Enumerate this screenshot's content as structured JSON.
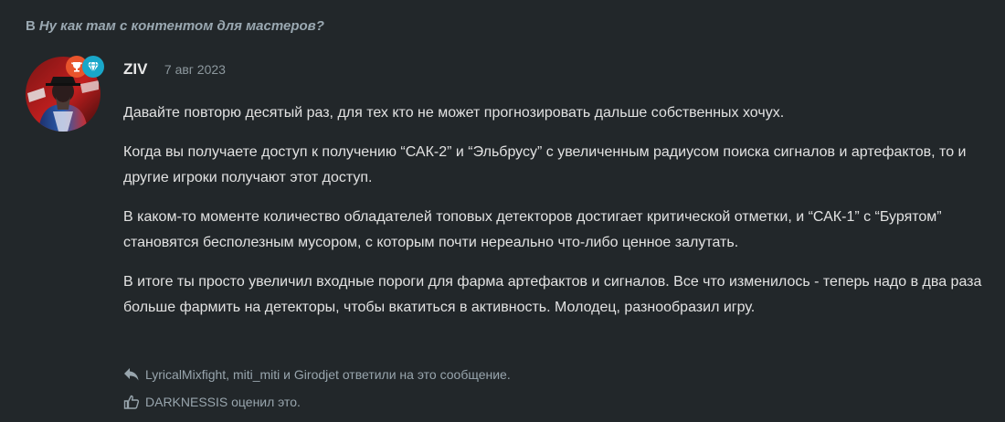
{
  "thread": {
    "prefix": "В",
    "title": "Ну как там с контентом для мастеров?"
  },
  "post": {
    "username": "ZIV",
    "date": "7 авг 2023",
    "paragraphs": [
      "Давайте повторю десятый раз, для тех кто не может прогнозировать дальше собственных хочух.",
      "Когда вы получаете доступ к получению “САК-2” и “Эльбрусу” с увеличенным радиусом поиска сигналов и артефактов, то и другие игроки получают этот доступ.",
      "В каком-то моменте количество обладателей топовых детекторов достигает критической отметки, и “САК-1” с “Бурятом” становятся бесполезным мусором, с которым почти нереально что-либо ценное залутать.",
      "В итоге ты просто увеличил входные пороги для фарма артефактов и сигналов. Все что изменилось - теперь надо в два раза больше фармить на детекторы, чтобы вкатиться в активность. Молодец, разнообразил игру."
    ],
    "replies": {
      "user1": "LyricalMixfight",
      "sep1": ", ",
      "user2": "miti_miti",
      "sep2": " и ",
      "user3": "Girodjet",
      "suffix": " ответили на это сообщение."
    },
    "likes": {
      "user": "DARKNESSIS",
      "suffix": " оценил это."
    }
  },
  "icons": {
    "badge_left": "trophy-icon",
    "badge_right": "diamond-icon",
    "reply": "reply-arrow-icon",
    "like": "thumbs-up-icon"
  },
  "colors": {
    "background": "#22272a",
    "badge_red": "#e8542c",
    "badge_blue": "#19a7c9"
  }
}
